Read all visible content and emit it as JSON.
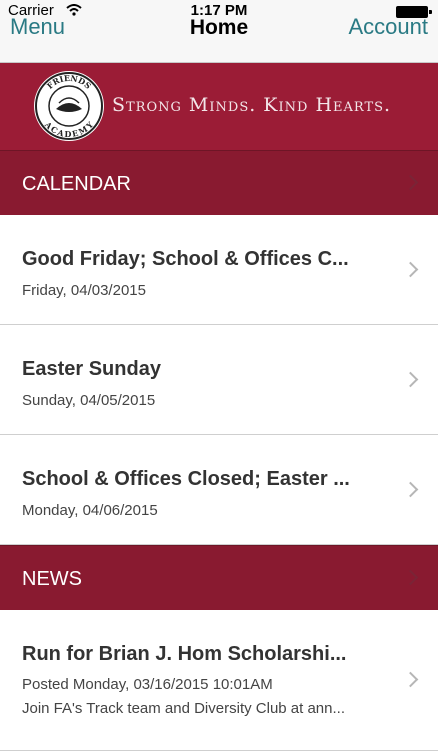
{
  "status_bar": {
    "carrier": "Carrier",
    "time": "1:17 PM"
  },
  "navbar": {
    "left_label": "Menu",
    "title": "Home",
    "right_label": "Account"
  },
  "banner": {
    "tagline": "Strong Minds. Kind Hearts.",
    "seal_text_top": "FRIENDS",
    "seal_text_bottom": "ACADEMY"
  },
  "calendar": {
    "header": "CALENDAR",
    "items": [
      {
        "title": "Good Friday; School & Offices C...",
        "date": "Friday, 04/03/2015"
      },
      {
        "title": "Easter Sunday",
        "date": "Sunday, 04/05/2015"
      },
      {
        "title": "School & Offices Closed; Easter ...",
        "date": "Monday, 04/06/2015"
      }
    ]
  },
  "news": {
    "header": "NEWS",
    "items": [
      {
        "title": "Run for Brian J. Hom Scholarshi...",
        "posted": "Posted Monday, 03/16/2015 10:01AM",
        "excerpt": "Join FA's Track team and Diversity Club at ann..."
      }
    ]
  },
  "colors": {
    "accent": "#2a7a84",
    "banner": "#9b1c36",
    "section": "#891a30"
  }
}
